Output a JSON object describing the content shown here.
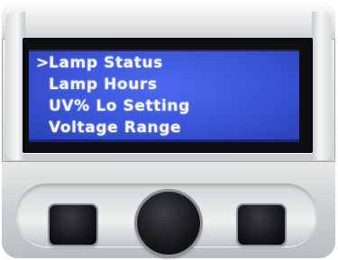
{
  "lcd": {
    "cursor": ">",
    "menu_items": [
      {
        "label": "Lamp Status",
        "selected": true
      },
      {
        "label": "Lamp Hours",
        "selected": false
      },
      {
        "label": "UV% Lo Setting",
        "selected": false
      },
      {
        "label": "Voltage Range",
        "selected": false
      }
    ],
    "backlight_color": "#3b55d9",
    "text_color": "#f4f6ff"
  },
  "controls": {
    "left_button_icon": "square-button",
    "center_button_icon": "round-select-button",
    "right_button_icon": "square-button"
  }
}
